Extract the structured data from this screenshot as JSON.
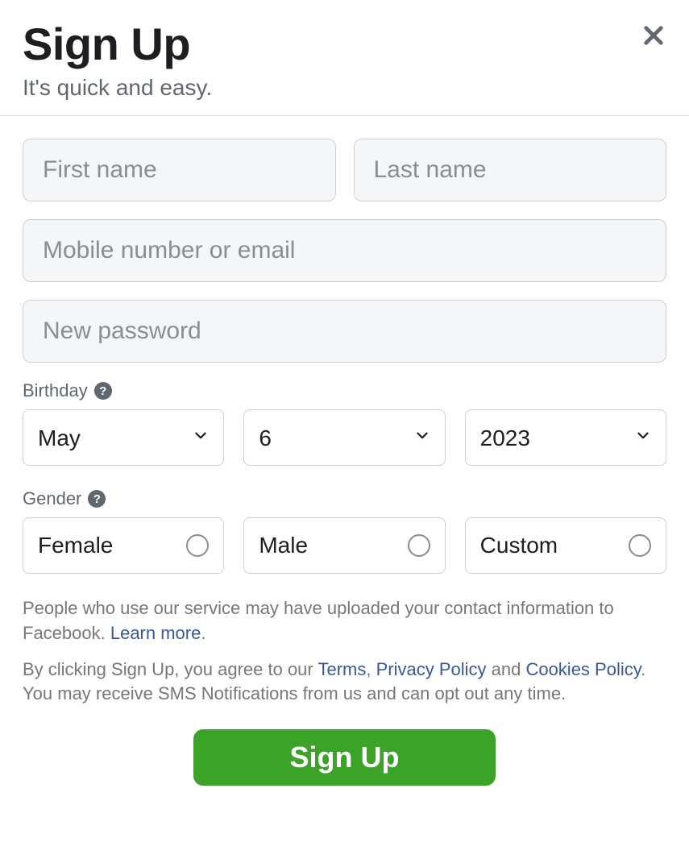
{
  "header": {
    "title": "Sign Up",
    "subtitle": "It's quick and easy."
  },
  "fields": {
    "first_name_placeholder": "First name",
    "last_name_placeholder": "Last name",
    "contact_placeholder": "Mobile number or email",
    "password_placeholder": "New password"
  },
  "birthday": {
    "label": "Birthday",
    "month": "May",
    "day": "6",
    "year": "2023"
  },
  "gender": {
    "label": "Gender",
    "options": {
      "female": "Female",
      "male": "Male",
      "custom": "Custom"
    }
  },
  "legal": {
    "contact_upload_prefix": "People who use our service may have uploaded your contact information to Facebook. ",
    "learn_more": "Learn more",
    "period": ".",
    "agree_prefix": "By clicking Sign Up, you agree to our ",
    "terms": "Terms",
    "comma": ", ",
    "privacy": "Privacy Policy",
    "and": " and ",
    "cookies": "Cookies Policy",
    "agree_suffix": ". You may receive SMS Notifications from us and can opt out any time."
  },
  "help_icon_glyph": "?",
  "submit_label": "Sign Up"
}
